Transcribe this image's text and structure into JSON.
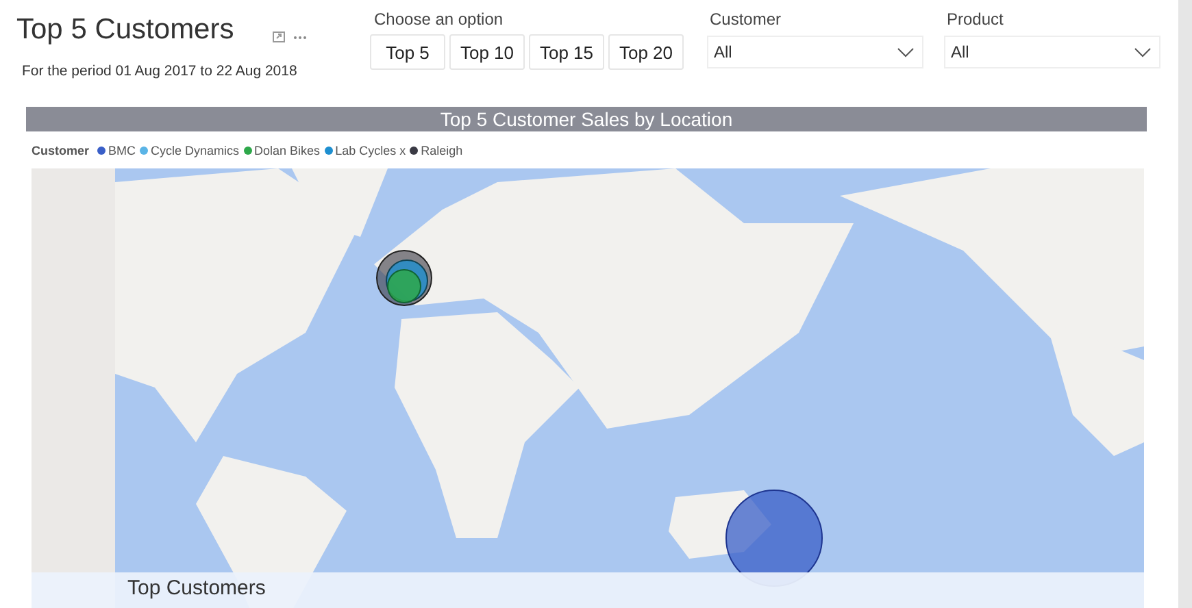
{
  "header": {
    "title": "Top 5 Customers",
    "subtitle": "For the period 01 Aug 2017 to 22 Aug 2018"
  },
  "option_group": {
    "label": "Choose an option",
    "buttons": [
      {
        "label": "Top 5",
        "selected": false
      },
      {
        "label": "Top 10",
        "selected": false
      },
      {
        "label": "Top 15",
        "selected": false
      },
      {
        "label": "Top 20",
        "selected": false
      }
    ]
  },
  "filters": [
    {
      "label": "Customer",
      "value": "All"
    },
    {
      "label": "Product",
      "value": "All"
    }
  ],
  "map_visual": {
    "title": "Top 5 Customer Sales by Location",
    "legend_title": "Customer",
    "legend": [
      {
        "label": "BMC",
        "color": "#3a5fc8"
      },
      {
        "label": "Cycle Dynamics",
        "color": "#5ab4e6"
      },
      {
        "label": "Dolan Bikes",
        "color": "#2ea84a"
      },
      {
        "label": "Lab Cycles x",
        "color": "#1e8fd0"
      },
      {
        "label": "Raleigh",
        "color": "#3a3a44"
      }
    ]
  },
  "bottom_visual": {
    "title": "Top Customers"
  }
}
